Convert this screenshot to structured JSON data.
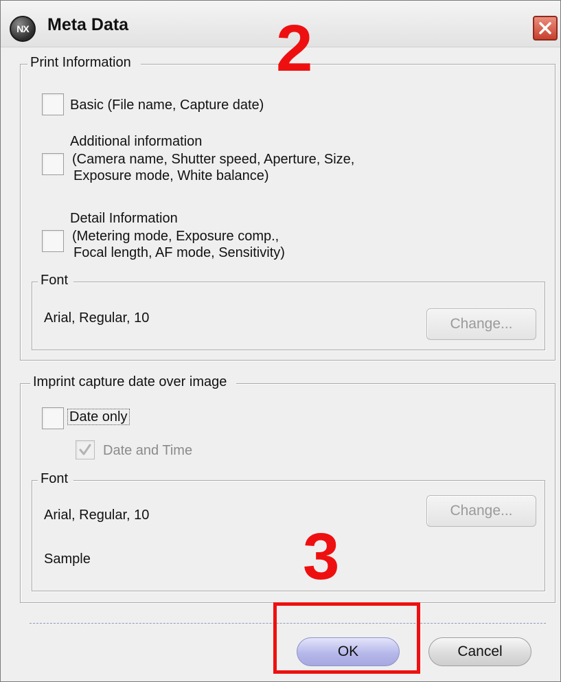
{
  "window": {
    "title": "Meta Data",
    "app_icon_text": "NX",
    "close_icon": "close-icon"
  },
  "print_information": {
    "legend": "Print Information",
    "options": [
      {
        "lines": [
          "Basic (File name, Capture date)"
        ],
        "checked": false
      },
      {
        "lines": [
          "Additional information",
          "(Camera name, Shutter speed, Aperture, Size,",
          "Exposure mode, White balance)"
        ],
        "checked": false
      },
      {
        "lines": [
          "Detail Information",
          "(Metering mode, Exposure comp.,",
          "Focal length, AF mode, Sensitivity)"
        ],
        "checked": false
      }
    ],
    "font": {
      "legend": "Font",
      "value": "Arial, Regular, 10",
      "change_label": "Change..."
    }
  },
  "imprint": {
    "legend": "Imprint capture date over image",
    "date_only_label": "Date only",
    "date_only_checked": false,
    "date_and_time_label": "Date and Time",
    "date_and_time_checked": true,
    "font": {
      "legend": "Font",
      "value": "Arial, Regular, 10",
      "change_label": "Change...",
      "sample_label": "Sample"
    }
  },
  "footer": {
    "ok_label": "OK",
    "cancel_label": "Cancel"
  },
  "annotations": {
    "step_2": "2",
    "step_3": "3",
    "highlight_color": "#ee1010"
  },
  "colors": {
    "dialog_bg": "#efefef",
    "ok_button": "#b6b8ea",
    "close_button": "#c6402d"
  }
}
